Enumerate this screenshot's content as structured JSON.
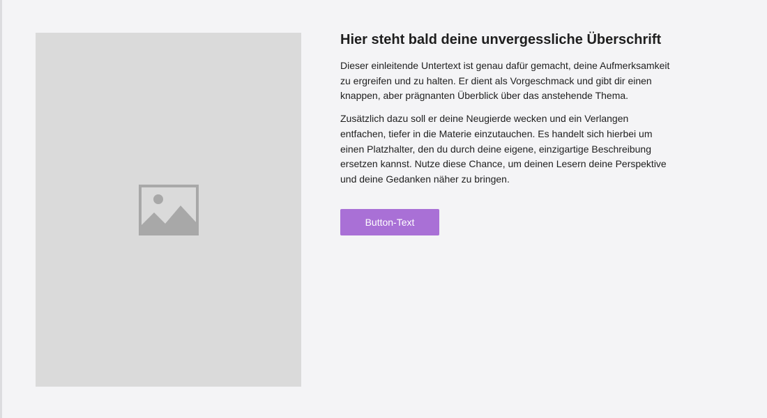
{
  "theme": {
    "page_background": "#f4f4f6",
    "image_placeholder_background": "#dadada",
    "image_icon_color": "#a8a8a8",
    "button_background": "#a970d6",
    "button_text_color": "#ffffff",
    "text_color": "#1e1e1e"
  },
  "media": {
    "icon": "image-placeholder-icon"
  },
  "content": {
    "heading": "Hier steht bald deine unvergessliche Überschrift",
    "paragraphs": [
      "Dieser einleitende Untertext ist genau dafür gemacht, deine Aufmerksamkeit zu ergreifen und zu halten. Er dient als Vorgeschmack und gibt dir einen knappen, aber prägnanten Überblick über das anstehende Thema.",
      "Zusätzlich dazu soll er deine Neugierde wecken und ein Verlangen entfachen, tiefer in die Materie einzutauchen. Es handelt sich hierbei um einen Platzhalter, den du durch deine eigene, einzigartige Beschreibung ersetzen kannst. Nutze diese Chance, um deinen Lesern deine Perspektive und deine Gedanken näher zu bringen."
    ],
    "button_label": "Button-Text"
  }
}
